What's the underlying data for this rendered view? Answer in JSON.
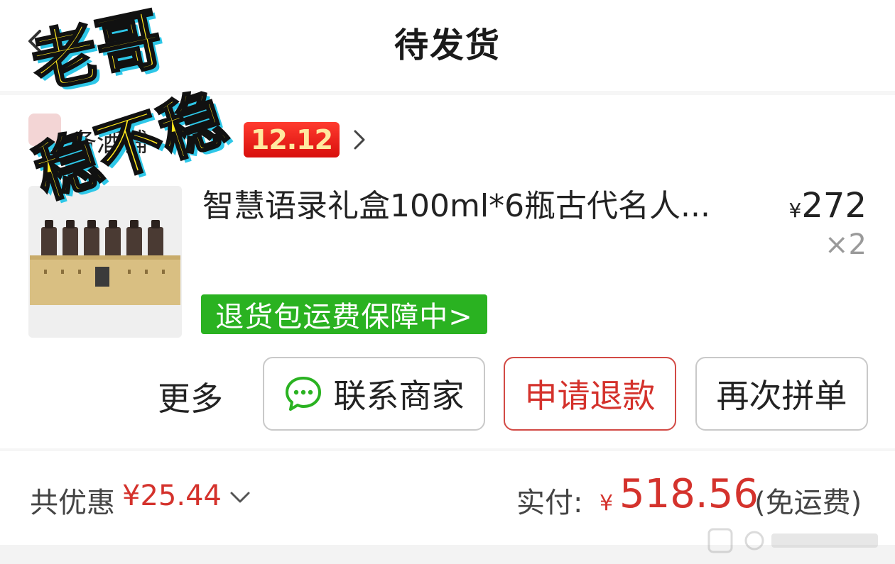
{
  "header": {
    "title": "待发货",
    "back_icon": "chevron-left-icon"
  },
  "overlay": {
    "sticker_line1": "老哥",
    "sticker_line2": "稳不稳"
  },
  "store": {
    "name": "备酒铺",
    "promo_badge": "12.12",
    "chevron_icon": "chevron-right-icon"
  },
  "product": {
    "title": "智慧语录礼盒100ml*6瓶古代名人...",
    "price_currency": "¥",
    "price": "272",
    "quantity": "×2",
    "guarantee": "退货包运费保障中>"
  },
  "actions": {
    "more": "更多",
    "contact_merchant": "联系商家",
    "request_refund": "申请退款",
    "reorder": "再次拼单"
  },
  "summary": {
    "discount_label": "共优惠",
    "discount_amount": "¥25.44",
    "paid_label": "实付:",
    "paid_currency": "¥",
    "paid_amount": "518.56",
    "shipping_note": "(免运费)"
  },
  "colors": {
    "accent_red": "#d4322c",
    "guarantee_green": "#2ab221",
    "promo_red": "#e01b14",
    "promo_text": "#ffe9a0"
  }
}
